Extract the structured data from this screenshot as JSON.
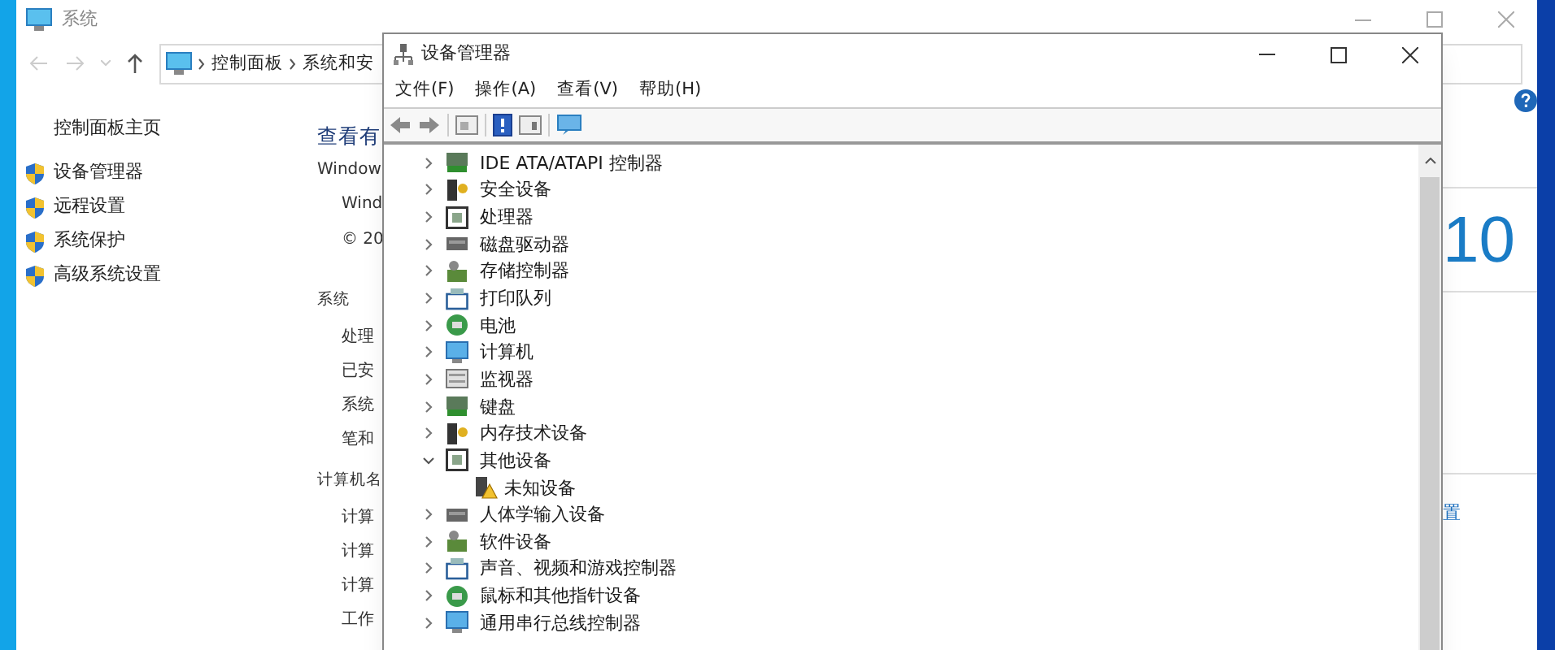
{
  "system_window": {
    "title": "系统",
    "breadcrumb": [
      "控制面板",
      "系统和安"
    ],
    "sidebar": {
      "home": "控制面板主页",
      "items": [
        "设备管理器",
        "远程设置",
        "系统保护",
        "高级系统设置"
      ]
    },
    "content": {
      "heading": "查看有",
      "edition_title": "Window",
      "edition_lines": [
        "Wind",
        "© 20"
      ],
      "sections": [
        {
          "title": "系统",
          "rows": [
            "处理",
            "已安",
            "系统",
            "笔和"
          ]
        },
        {
          "title": "计算机名",
          "rows": [
            "计算",
            "计算",
            "计算",
            "工作"
          ]
        }
      ],
      "logo_text": "10",
      "link": "置"
    }
  },
  "device_manager": {
    "title": "设备管理器",
    "menu": [
      "文件(F)",
      "操作(A)",
      "查看(V)",
      "帮助(H)"
    ],
    "tree": [
      {
        "label": "IDE ATA/ATAPI 控制器",
        "expanded": false
      },
      {
        "label": "安全设备",
        "expanded": false
      },
      {
        "label": "处理器",
        "expanded": false
      },
      {
        "label": "磁盘驱动器",
        "expanded": false
      },
      {
        "label": "存储控制器",
        "expanded": false
      },
      {
        "label": "打印队列",
        "expanded": false
      },
      {
        "label": "电池",
        "expanded": false
      },
      {
        "label": "计算机",
        "expanded": false
      },
      {
        "label": "监视器",
        "expanded": false
      },
      {
        "label": "键盘",
        "expanded": false
      },
      {
        "label": "内存技术设备",
        "expanded": false
      },
      {
        "label": "其他设备",
        "expanded": true,
        "children": [
          {
            "label": "未知设备",
            "kind": "warning"
          }
        ]
      },
      {
        "label": "人体学输入设备",
        "expanded": false
      },
      {
        "label": "软件设备",
        "expanded": false
      },
      {
        "label": "声音、视频和游戏控制器",
        "expanded": false
      },
      {
        "label": "鼠标和其他指针设备",
        "expanded": false
      },
      {
        "label": "通用串行总线控制器",
        "expanded": false
      }
    ]
  }
}
